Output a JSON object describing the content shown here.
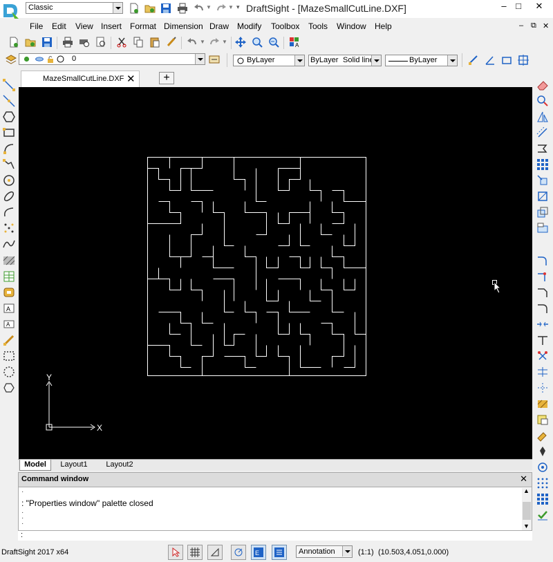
{
  "titlebar": {
    "workspace": "Classic",
    "title": "DraftSight - [MazeSmallCutLine.DXF]",
    "minimize": "–",
    "maximize": "□",
    "close": "✕"
  },
  "menu": {
    "items": [
      "File",
      "Edit",
      "View",
      "Insert",
      "Format",
      "Dimension",
      "Draw",
      "Modify",
      "Toolbox",
      "Tools",
      "Window",
      "Help"
    ],
    "doc_minimize": "–",
    "doc_restore": "⧉",
    "doc_close": "✕"
  },
  "layer_toolbar": {
    "layer_value": "0"
  },
  "properties_toolbar": {
    "color": "ByLayer",
    "linestyle": "ByLayer",
    "linestyle_name": "Solid line",
    "lineweight": "ByLayer"
  },
  "document_tab": {
    "label": "MazeSmallCutLine.DXF",
    "close": "✕",
    "new_tab": "+"
  },
  "layout_tabs": [
    "Model",
    "Layout1",
    "Layout2"
  ],
  "ucs": {
    "x_label": "X",
    "y_label": "Y"
  },
  "command_window": {
    "title": "Command window",
    "close": "✕",
    "message": ": \"Properties window\" palette closed",
    "prompt": ":"
  },
  "statusbar": {
    "app_version": "DraftSight 2017 x64",
    "annotation": "Annotation",
    "scale": "(1:1)",
    "coordinates": "(10.503,4.051,0.000)"
  },
  "colors": {
    "canvas": "#000000",
    "drawing_lines": "#ffffff",
    "accent_blue": "#1f63c6",
    "accent_green": "#3c9a2c"
  }
}
